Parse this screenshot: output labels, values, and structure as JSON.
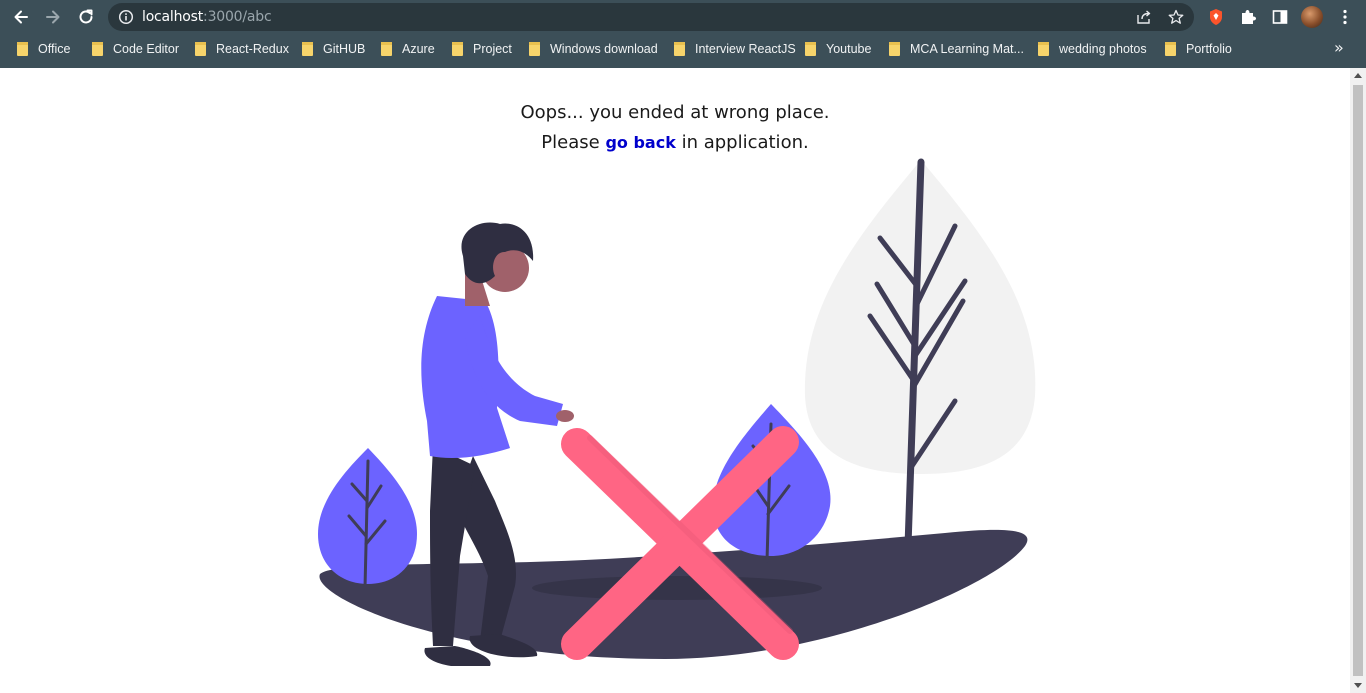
{
  "browser": {
    "url_host": "localhost",
    "url_path": ":3000/abc",
    "icons": {
      "back": "back-arrow-icon",
      "forward": "forward-arrow-icon",
      "reload": "reload-icon",
      "site_info": "info-icon",
      "share": "share-icon",
      "bookmark_star": "star-icon",
      "brave": "brave-shield-icon",
      "extensions": "puzzle-icon",
      "side_panel": "side-panel-icon",
      "menu": "kebab-menu-icon"
    },
    "bookmarks": [
      {
        "label": "Office"
      },
      {
        "label": "Code Editor"
      },
      {
        "label": "React-Redux"
      },
      {
        "label": "GitHUB"
      },
      {
        "label": "Azure"
      },
      {
        "label": "Project"
      },
      {
        "label": "Windows download"
      },
      {
        "label": "Interview ReactJS"
      },
      {
        "label": "Youtube"
      },
      {
        "label": "MCA Learning Mat..."
      },
      {
        "label": "wedding photos"
      },
      {
        "label": "Portfolio"
      }
    ],
    "more_bookmarks": "»"
  },
  "page": {
    "line1": "Oops... you ended at wrong place.",
    "line2_prefix": "Please",
    "link_text": "go back",
    "line2_suffix": "in application."
  },
  "colors": {
    "chrome_bg": "#3c4f58",
    "accent_purple": "#6c63ff",
    "cross_pink": "#ff6584",
    "ground_dark": "#3f3d56",
    "tree_light": "#f2f2f2",
    "link_blue": "#0000cc"
  }
}
